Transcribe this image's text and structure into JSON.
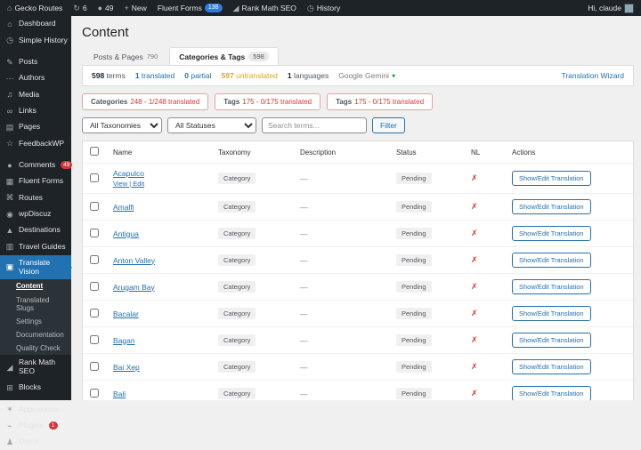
{
  "colors": {
    "accent": "#2271b1",
    "red": "#d63638",
    "warning": "#dba617",
    "success": "#00a32a",
    "bar_bg": "#1d2327",
    "submenu_bg": "#2c3338",
    "page_bg": "#f0f0f1",
    "fluent_badge": "#2b7de0"
  },
  "admin_bar": {
    "site_name": "Gecko Routes",
    "updates_count": "6",
    "comments_count": "49",
    "new_label": "New",
    "fluent_forms_label": "Fluent Forms",
    "fluent_forms_badge": "138",
    "rank_math_label": "Rank Math SEO",
    "history_label": "History",
    "greeting": "Hi, claude"
  },
  "sidebar": {
    "items": [
      {
        "icon": "dashboard-icon",
        "glyph": "⌂",
        "label": "Dashboard"
      },
      {
        "icon": "simple-history-icon",
        "glyph": "◷",
        "label": "Simple History"
      },
      {
        "type": "sep"
      },
      {
        "icon": "posts-icon",
        "glyph": "✎",
        "label": "Posts"
      },
      {
        "icon": "authors-icon",
        "glyph": "⋯",
        "label": "Authors"
      },
      {
        "icon": "media-icon",
        "glyph": "♫",
        "label": "Media"
      },
      {
        "icon": "links-icon",
        "glyph": "∞",
        "label": "Links"
      },
      {
        "icon": "pages-icon",
        "glyph": "▤",
        "label": "Pages"
      },
      {
        "icon": "feedbackwp-icon",
        "glyph": "☆",
        "label": "FeedbackWP"
      },
      {
        "type": "sep"
      },
      {
        "icon": "comments-icon",
        "glyph": "●",
        "label": "Comments",
        "badge": "49"
      },
      {
        "icon": "fluent-forms-icon",
        "glyph": "▦",
        "label": "Fluent Forms"
      },
      {
        "icon": "routes-icon",
        "glyph": "⌘",
        "label": "Routes"
      },
      {
        "icon": "wpdiscuz-icon",
        "glyph": "◉",
        "label": "wpDiscuz"
      },
      {
        "icon": "destinations-icon",
        "glyph": "▲",
        "label": "Destinations"
      },
      {
        "icon": "travel-guides-icon",
        "glyph": "▥",
        "label": "Travel Guides"
      },
      {
        "icon": "translate-vision-icon",
        "glyph": "▣",
        "label": "Translate Vision",
        "active": true
      },
      {
        "type": "sub subcur",
        "label": "Content"
      },
      {
        "type": "sub",
        "label": "Translated Slugs"
      },
      {
        "type": "sub",
        "label": "Settings"
      },
      {
        "type": "sub",
        "label": "Documentation"
      },
      {
        "type": "sub",
        "label": "Quality Check"
      },
      {
        "icon": "rank-math-icon",
        "glyph": "◢",
        "label": "Rank Math SEO"
      },
      {
        "icon": "blocks-icon",
        "glyph": "⊞",
        "label": "Blocks"
      },
      {
        "type": "sep"
      },
      {
        "icon": "appearance-icon",
        "glyph": "✶",
        "label": "Appearance"
      },
      {
        "icon": "plugins-icon",
        "glyph": "⌁",
        "label": "Plugins",
        "badge": "1"
      },
      {
        "icon": "users-icon",
        "glyph": "♟",
        "label": "Users"
      }
    ]
  },
  "page": {
    "title": "Content",
    "tabs": [
      {
        "label": "Posts & Pages",
        "count": "790",
        "active": false
      },
      {
        "label": "Categories & Tags",
        "count": "598",
        "active": true
      }
    ],
    "stats": [
      {
        "num": "598",
        "label": "terms",
        "type": "plain"
      },
      {
        "num": "1",
        "label": "translated",
        "type": "link"
      },
      {
        "num": "0",
        "label": "partial",
        "type": "link"
      },
      {
        "num": "597",
        "label": "untranslated",
        "type": "warn"
      },
      {
        "num": "1",
        "label": "languages",
        "type": "plain"
      }
    ],
    "engine": {
      "label": "Google Gemini",
      "dot": "●"
    },
    "wizard_label": "Translation Wizard",
    "tax_buttons": [
      {
        "name": "Categories",
        "detail": "248 - 1/248 translated"
      },
      {
        "name": "Tags",
        "detail": "175 - 0/175 translated"
      },
      {
        "name": "Tags",
        "detail": "175 - 0/175 translated"
      }
    ],
    "filters": {
      "taxonomy_value": "All Taxonomies",
      "status_value": "All Statuses",
      "search_placeholder": "Search terms...",
      "filter_label": "Filter"
    },
    "table": {
      "headers": {
        "name": "Name",
        "taxonomy": "Taxonomy",
        "description": "Description",
        "status": "Status",
        "nl": "NL",
        "actions": "Actions"
      },
      "rows": [
        {
          "name": "Acapulco",
          "links": "View | Edit",
          "taxonomy": "Category",
          "description": "—",
          "status": "Pending",
          "nl": "✗",
          "action": "Show/Edit Translation"
        },
        {
          "name": "Amalfi",
          "links": "",
          "taxonomy": "Category",
          "description": "—",
          "status": "Pending",
          "nl": "✗",
          "action": "Show/Edit Translation"
        },
        {
          "name": "Antigua",
          "links": "",
          "taxonomy": "Category",
          "description": "—",
          "status": "Pending",
          "nl": "✗",
          "action": "Show/Edit Translation"
        },
        {
          "name": "Anton Valley",
          "links": "",
          "taxonomy": "Category",
          "description": "—",
          "status": "Pending",
          "nl": "✗",
          "action": "Show/Edit Translation"
        },
        {
          "name": "Arugam Bay",
          "links": "",
          "taxonomy": "Category",
          "description": "—",
          "status": "Pending",
          "nl": "✗",
          "action": "Show/Edit Translation"
        },
        {
          "name": "Bacalar",
          "links": "",
          "taxonomy": "Category",
          "description": "—",
          "status": "Pending",
          "nl": "✗",
          "action": "Show/Edit Translation"
        },
        {
          "name": "Bagan",
          "links": "",
          "taxonomy": "Category",
          "description": "—",
          "status": "Pending",
          "nl": "✗",
          "action": "Show/Edit Translation"
        },
        {
          "name": "Bai Xep",
          "links": "",
          "taxonomy": "Category",
          "description": "—",
          "status": "Pending",
          "nl": "✗",
          "action": "Show/Edit Translation"
        },
        {
          "name": "Bali",
          "links": "",
          "taxonomy": "Category",
          "description": "—",
          "status": "Pending",
          "nl": "✗",
          "action": "Show/Edit Translation"
        }
      ]
    }
  }
}
